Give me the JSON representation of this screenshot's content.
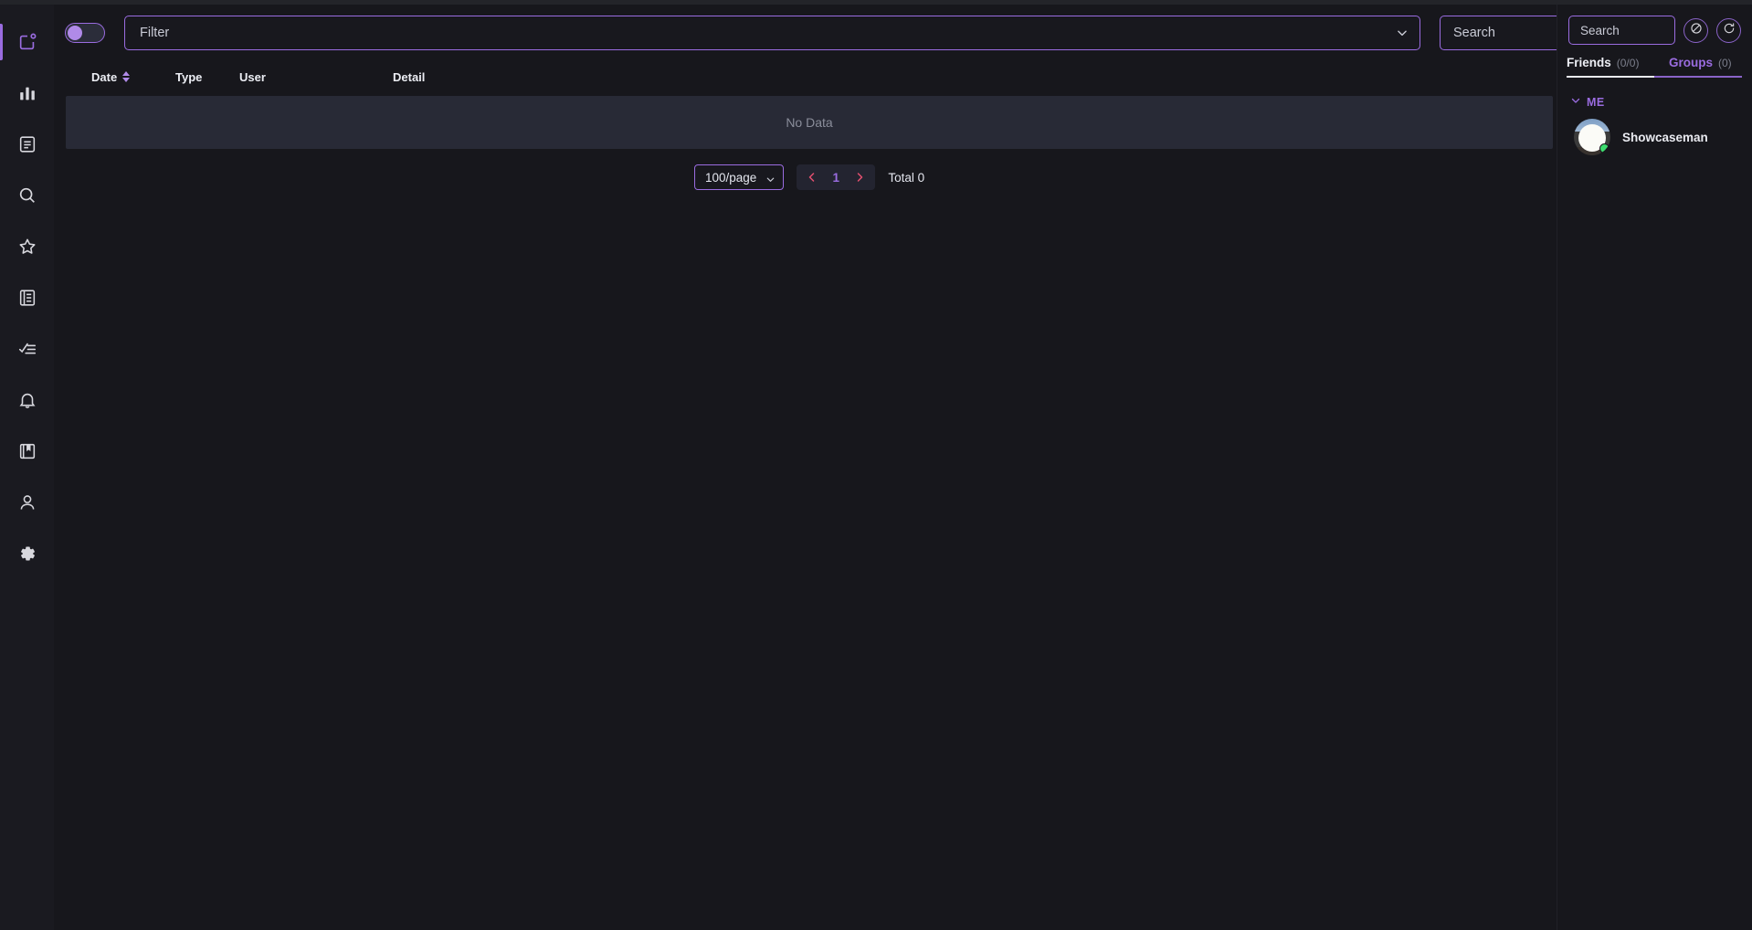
{
  "window": {
    "background": "#17171c",
    "accent": "#9a6ce0"
  },
  "sidebar": {
    "items": [
      {
        "icon": "app-window-icon",
        "name": "sidebar-item-dashboard",
        "active": true
      },
      {
        "icon": "bar-chart-icon",
        "name": "sidebar-item-statistics",
        "active": false
      },
      {
        "icon": "document-icon",
        "name": "sidebar-item-logs",
        "active": false
      },
      {
        "icon": "search-icon",
        "name": "sidebar-item-search",
        "active": false
      },
      {
        "icon": "star-icon",
        "name": "sidebar-item-favorites",
        "active": false
      },
      {
        "icon": "notebook-icon",
        "name": "sidebar-item-library",
        "active": false
      },
      {
        "icon": "checklist-icon",
        "name": "sidebar-item-tasks",
        "active": false
      },
      {
        "icon": "bell-icon",
        "name": "sidebar-item-notifications",
        "active": false
      },
      {
        "icon": "book-icon",
        "name": "sidebar-item-bookmarks",
        "active": false
      },
      {
        "icon": "user-icon",
        "name": "sidebar-item-profile",
        "active": false
      },
      {
        "icon": "gear-icon",
        "name": "sidebar-item-settings",
        "active": false
      }
    ]
  },
  "filterbar": {
    "toggle": {
      "label": "feed-toggle",
      "on": false
    },
    "filter_select": {
      "value": "Filter",
      "chevron": "chevron-down-icon"
    },
    "search": {
      "value": "",
      "placeholder": "Search"
    }
  },
  "table": {
    "columns": [
      {
        "key": "date",
        "label": "Date",
        "sortable": true
      },
      {
        "key": "type",
        "label": "Type",
        "sortable": false
      },
      {
        "key": "user",
        "label": "User",
        "sortable": false
      },
      {
        "key": "detail",
        "label": "Detail",
        "sortable": false
      }
    ],
    "rows": [],
    "empty_text": "No Data"
  },
  "pagination": {
    "per_page": "100/page",
    "prev_icon": "chevron-left-icon",
    "next_icon": "chevron-right-icon",
    "current_page": "1",
    "total_label": "Total 0"
  },
  "right_panel": {
    "search": {
      "value": "",
      "placeholder": "Search"
    },
    "actions": [
      {
        "name": "block-button",
        "icon": "circle-slash-icon"
      },
      {
        "name": "refresh-button",
        "icon": "refresh-icon"
      }
    ],
    "tabs": [
      {
        "label": "Friends",
        "count": "(0/0)",
        "active": true
      },
      {
        "label": "Groups",
        "count": "(0)",
        "active": false
      }
    ],
    "groups": [
      {
        "label": "ME",
        "collapse_icon": "chevron-down-icon",
        "members": [
          {
            "name": "Showcaseman",
            "status": "online",
            "status_color": "#3ddc6e"
          }
        ]
      }
    ]
  }
}
